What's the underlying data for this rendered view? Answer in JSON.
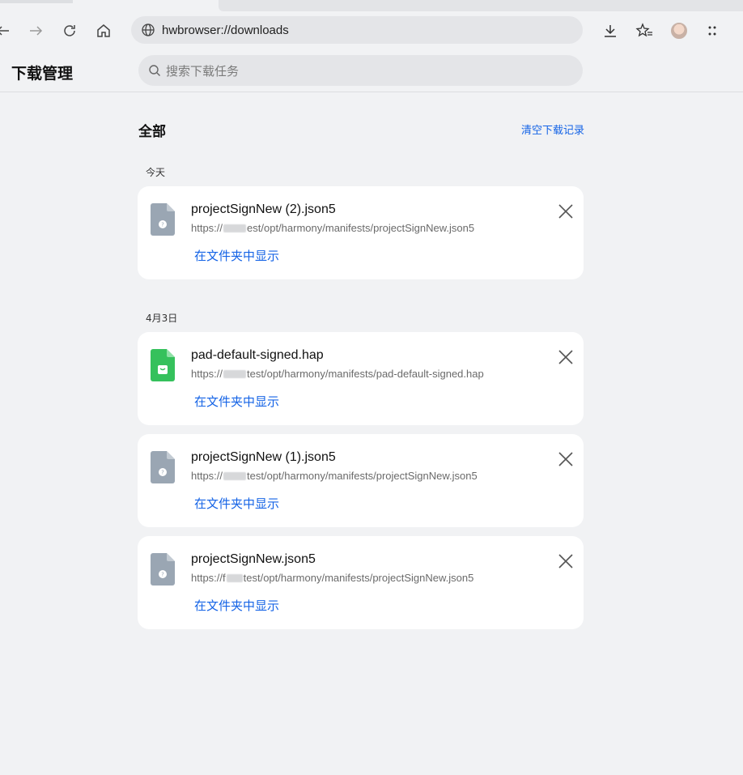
{
  "browser": {
    "url": "hwbrowser://downloads",
    "icons": [
      "back-icon",
      "forward-icon",
      "reload-icon",
      "home-icon",
      "globe-icon",
      "download-icon",
      "favorites-icon",
      "avatar",
      "more-icon"
    ]
  },
  "header": {
    "title": "下载管理",
    "search_placeholder": "搜索下载任务"
  },
  "section": {
    "title": "全部",
    "clear_label": "清空下载记录"
  },
  "groups": [
    {
      "date": "今天",
      "items": [
        {
          "name": "projectSignNew (2).json5",
          "url_prefix": "https://",
          "url_suffix": "est/opt/harmony/manifests/projectSignNew.json5",
          "action": "在文件夹中显示",
          "icon": "json-file-icon"
        }
      ]
    },
    {
      "date": "4月3日",
      "items": [
        {
          "name": "pad-default-signed.hap",
          "url_prefix": "https://",
          "url_suffix": "test/opt/harmony/manifests/pad-default-signed.hap",
          "action": "在文件夹中显示",
          "icon": "hap-file-icon"
        },
        {
          "name": "projectSignNew (1).json5",
          "url_prefix": "https://",
          "url_suffix": "test/opt/harmony/manifests/projectSignNew.json5",
          "action": "在文件夹中显示",
          "icon": "json-file-icon"
        },
        {
          "name": "projectSignNew.json5",
          "url_prefix": "https://f",
          "url_suffix": "test/opt/harmony/manifests/projectSignNew.json5",
          "action": "在文件夹中显示",
          "icon": "json-file-icon"
        }
      ]
    }
  ],
  "colors": {
    "accent": "#1463e6",
    "background": "#f1f2f4",
    "card": "#ffffff",
    "hap_icon": "#35c15c",
    "json_icon": "#9aa6b3"
  }
}
